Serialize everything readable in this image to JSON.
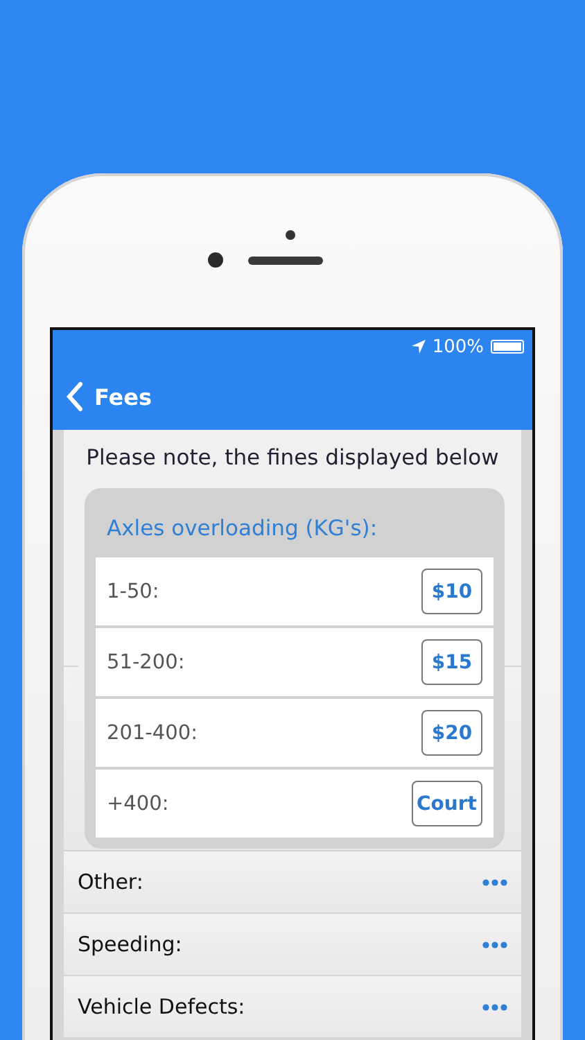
{
  "status_bar": {
    "battery": "100%"
  },
  "nav": {
    "title": "Fees"
  },
  "note_lines": [
    "Please note, the fines displayed below"
  ],
  "categories": [
    {
      "label": "Other:"
    },
    {
      "label": "Speeding:"
    },
    {
      "label": "Vehicle Defects:"
    }
  ],
  "popover": {
    "title": "Axles overloading (KG's):",
    "rows": [
      {
        "range": "1-50:",
        "fee": "$10"
      },
      {
        "range": "51-200:",
        "fee": "$15"
      },
      {
        "range": "201-400:",
        "fee": "$20"
      },
      {
        "range": "+400:",
        "fee": "Court"
      }
    ]
  }
}
